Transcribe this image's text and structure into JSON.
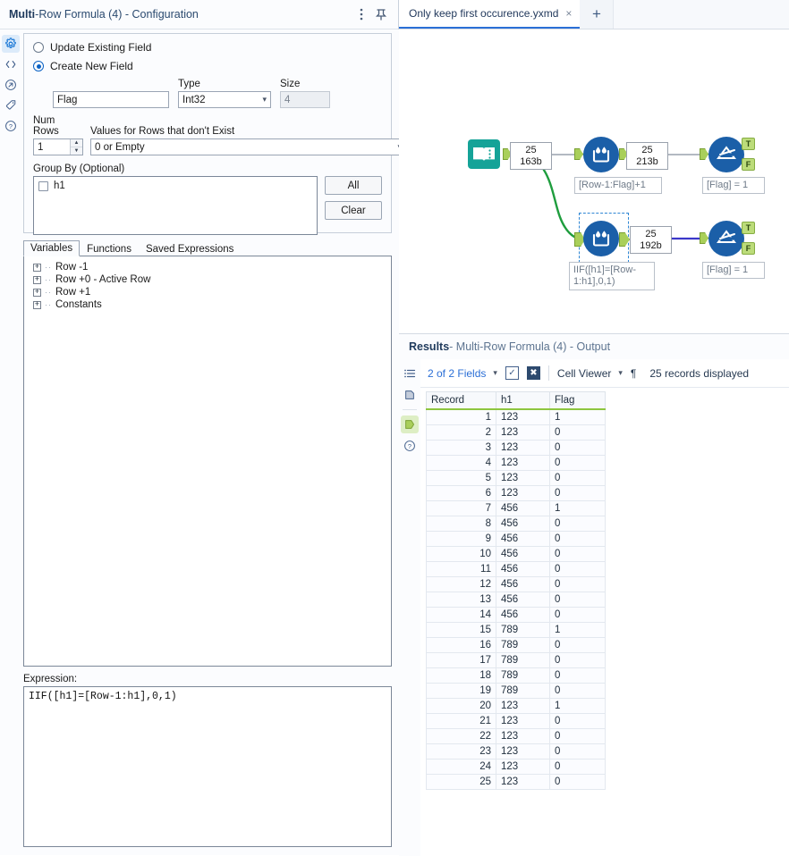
{
  "config_panel": {
    "title_bold": "Multi",
    "title_rest": "-Row Formula (4) - Configuration",
    "menu_icon": "more-vertical-icon",
    "pin_icon": "pin-icon",
    "rail": [
      {
        "name": "configuration-gear-icon",
        "glyph": "gear",
        "active": true
      },
      {
        "name": "code-brackets-icon",
        "glyph": "code",
        "active": false
      },
      {
        "name": "run-arrow-icon",
        "glyph": "arrow",
        "active": false
      },
      {
        "name": "annotation-tag-icon",
        "glyph": "tag",
        "active": false
      },
      {
        "name": "help-question-icon",
        "glyph": "help",
        "active": false
      }
    ],
    "radio_update": "Update Existing Field",
    "radio_create": "Create New  Field",
    "selected_radio": "create",
    "field_name_value": "Flag",
    "type_label": "Type",
    "type_value": "Int32",
    "size_label": "Size",
    "size_value": "4",
    "num_rows_label": "Num Rows",
    "num_rows_value": "1",
    "values_missing_label": "Values for Rows that don't Exist",
    "values_missing_value": "0 or Empty",
    "group_by_label": "Group By (Optional)",
    "group_by_items": [
      {
        "label": "h1",
        "checked": false
      }
    ],
    "all_button": "All",
    "clear_button": "Clear",
    "tabs": [
      {
        "label": "Variables",
        "active": true
      },
      {
        "label": "Functions",
        "active": false
      },
      {
        "label": "Saved Expressions",
        "active": false
      }
    ],
    "tree": [
      {
        "label": "Row -1"
      },
      {
        "label": "Row +0 - Active Row"
      },
      {
        "label": "Row +1"
      },
      {
        "label": "Constants"
      }
    ],
    "expression_label": "Expression:",
    "expression_value": "IIF([h1]=[Row-1:h1],0,1)"
  },
  "document_tabs": {
    "tabs": [
      {
        "label": "Only keep first occurence.yxmd",
        "close": "×",
        "active": true
      }
    ],
    "new_tab": "+"
  },
  "canvas": {
    "nodes": [
      {
        "name": "text-input-tool",
        "type": "text-input",
        "label": ""
      },
      {
        "name": "multi-row-formula-tool-top",
        "type": "multi-row-formula",
        "label": "[Row-1:Flag]+1"
      },
      {
        "name": "filter-tool-top",
        "type": "filter",
        "label": "[Flag] = 1"
      },
      {
        "name": "multi-row-formula-tool-bottom",
        "type": "multi-row-formula",
        "label": "IIF([h1]=[Row-1:h1],0,1)"
      },
      {
        "name": "filter-tool-bottom",
        "type": "filter",
        "label": "[Flag] = 1"
      }
    ],
    "record_counts": [
      {
        "name": "record-count-input",
        "records": "25",
        "size": "163b"
      },
      {
        "name": "record-count-top-formula",
        "records": "25",
        "size": "213b"
      },
      {
        "name": "record-count-bottom-formula",
        "records": "25",
        "size": "192b"
      }
    ],
    "filter_anchors": {
      "true": "T",
      "false": "F"
    }
  },
  "results": {
    "title_bold": "Results",
    "title_rest": " - Multi-Row Formula (4) - Output",
    "rail": [
      {
        "name": "list-view-icon",
        "active": false
      },
      {
        "name": "data-panel-icon",
        "active": false
      },
      {
        "name": "output-anchor-icon",
        "active": true
      },
      {
        "name": "help-question-icon",
        "active": false
      }
    ],
    "toolbar": {
      "fields_label": "2 of 2 Fields",
      "select_all_icon": "checkbox-check-icon",
      "deselect_all_icon": "checkbox-cross-icon",
      "viewer_label": "Cell Viewer",
      "pilcrow_icon": "¶",
      "records_displayed": "25 records displayed"
    },
    "grid": {
      "columns": [
        "Record",
        "h1",
        "Flag"
      ],
      "rows": [
        [
          "1",
          "123",
          "1"
        ],
        [
          "2",
          "123",
          "0"
        ],
        [
          "3",
          "123",
          "0"
        ],
        [
          "4",
          "123",
          "0"
        ],
        [
          "5",
          "123",
          "0"
        ],
        [
          "6",
          "123",
          "0"
        ],
        [
          "7",
          "456",
          "1"
        ],
        [
          "8",
          "456",
          "0"
        ],
        [
          "9",
          "456",
          "0"
        ],
        [
          "10",
          "456",
          "0"
        ],
        [
          "11",
          "456",
          "0"
        ],
        [
          "12",
          "456",
          "0"
        ],
        [
          "13",
          "456",
          "0"
        ],
        [
          "14",
          "456",
          "0"
        ],
        [
          "15",
          "789",
          "1"
        ],
        [
          "16",
          "789",
          "0"
        ],
        [
          "17",
          "789",
          "0"
        ],
        [
          "18",
          "789",
          "0"
        ],
        [
          "19",
          "789",
          "0"
        ],
        [
          "20",
          "123",
          "1"
        ],
        [
          "21",
          "123",
          "0"
        ],
        [
          "22",
          "123",
          "0"
        ],
        [
          "23",
          "123",
          "0"
        ],
        [
          "24",
          "123",
          "0"
        ],
        [
          "25",
          "123",
          "0"
        ]
      ]
    }
  },
  "colors": {
    "accent_blue": "#2b6fd6",
    "tool_blue": "#1b5fa8",
    "text_input_teal": "#15a398",
    "anchor_green": "#a9cf5a",
    "connection_green": "#1f9d3e",
    "connection_blue": "#3b37c9",
    "header_underline_green": "#8ec63f"
  }
}
